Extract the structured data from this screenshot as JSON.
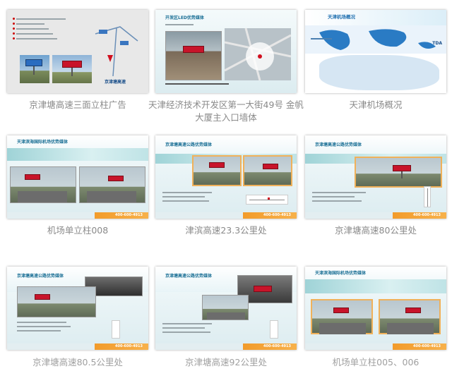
{
  "gallery": {
    "items": [
      {
        "caption": "京津塘高速三面立柱广告",
        "thumb": {
          "label": "京津塘高速"
        }
      },
      {
        "caption": "天津经济技术开发区第一大街49号  金帆大厦主入口墙体",
        "thumb": {
          "title": "开发区LED优势媒体"
        }
      },
      {
        "caption": "天津机场概况",
        "thumb": {
          "title": "天津机场概况"
        }
      },
      {
        "caption": "机场单立柱008",
        "thumb": {
          "title": "天津滨海国际机场优势媒体"
        }
      },
      {
        "caption": "津滨高速23.3公里处",
        "thumb": {
          "title": "京津塘高速公路优势媒体"
        }
      },
      {
        "caption": "京津塘高速80公里处",
        "thumb": {
          "title": "京津塘高速公路优势媒体"
        }
      },
      {
        "caption": "京津塘高速80.5公里处",
        "thumb": {
          "title": "京津塘高速公路优势媒体"
        }
      },
      {
        "caption": "京津塘高速92公里处",
        "thumb": {
          "title": "京津塘高速公路优势媒体"
        }
      },
      {
        "caption": "机场单立柱005、006",
        "thumb": {
          "title": "天津滨海国际机场优势媒体"
        }
      }
    ]
  },
  "footer_phone": "400-600-4913",
  "colors": {
    "accent": "#f29b2b",
    "teal": "#9fd3d7",
    "billboard": "#c8142a",
    "caption": "#8a8a8a"
  }
}
